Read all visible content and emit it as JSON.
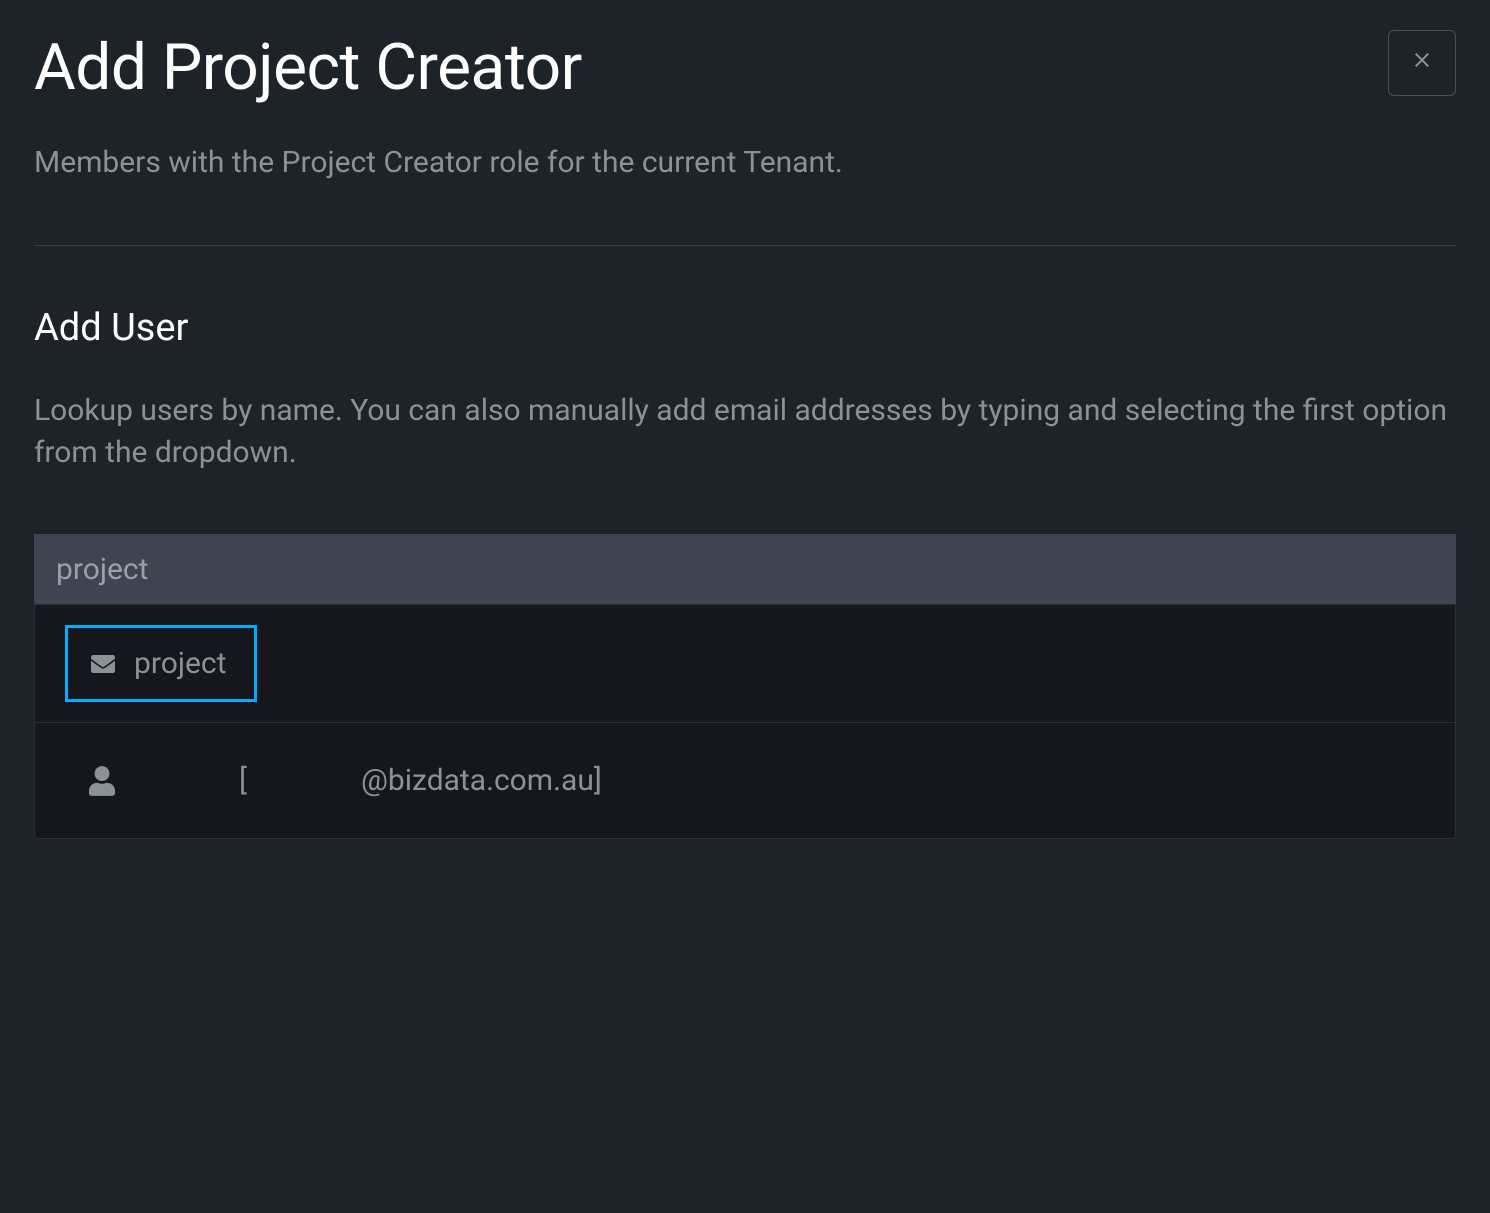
{
  "modal": {
    "title": "Add Project Creator",
    "subtitle": "Members with the Project Creator role for the current Tenant.",
    "close_icon": "close"
  },
  "section": {
    "title": "Add User",
    "description": "Lookup users by name. You can also manually add email addresses by typing and selecting the first option from the dropdown."
  },
  "search": {
    "value": "project",
    "placeholder": ""
  },
  "dropdown": {
    "options": [
      {
        "type": "email",
        "icon": "envelope",
        "label": "project",
        "highlighted": true
      },
      {
        "type": "user",
        "icon": "user",
        "name_redacted": true,
        "bracket_open": "[",
        "email_prefix_redacted": true,
        "email_suffix": "@bizdata.com.au]",
        "highlighted": false
      }
    ]
  }
}
